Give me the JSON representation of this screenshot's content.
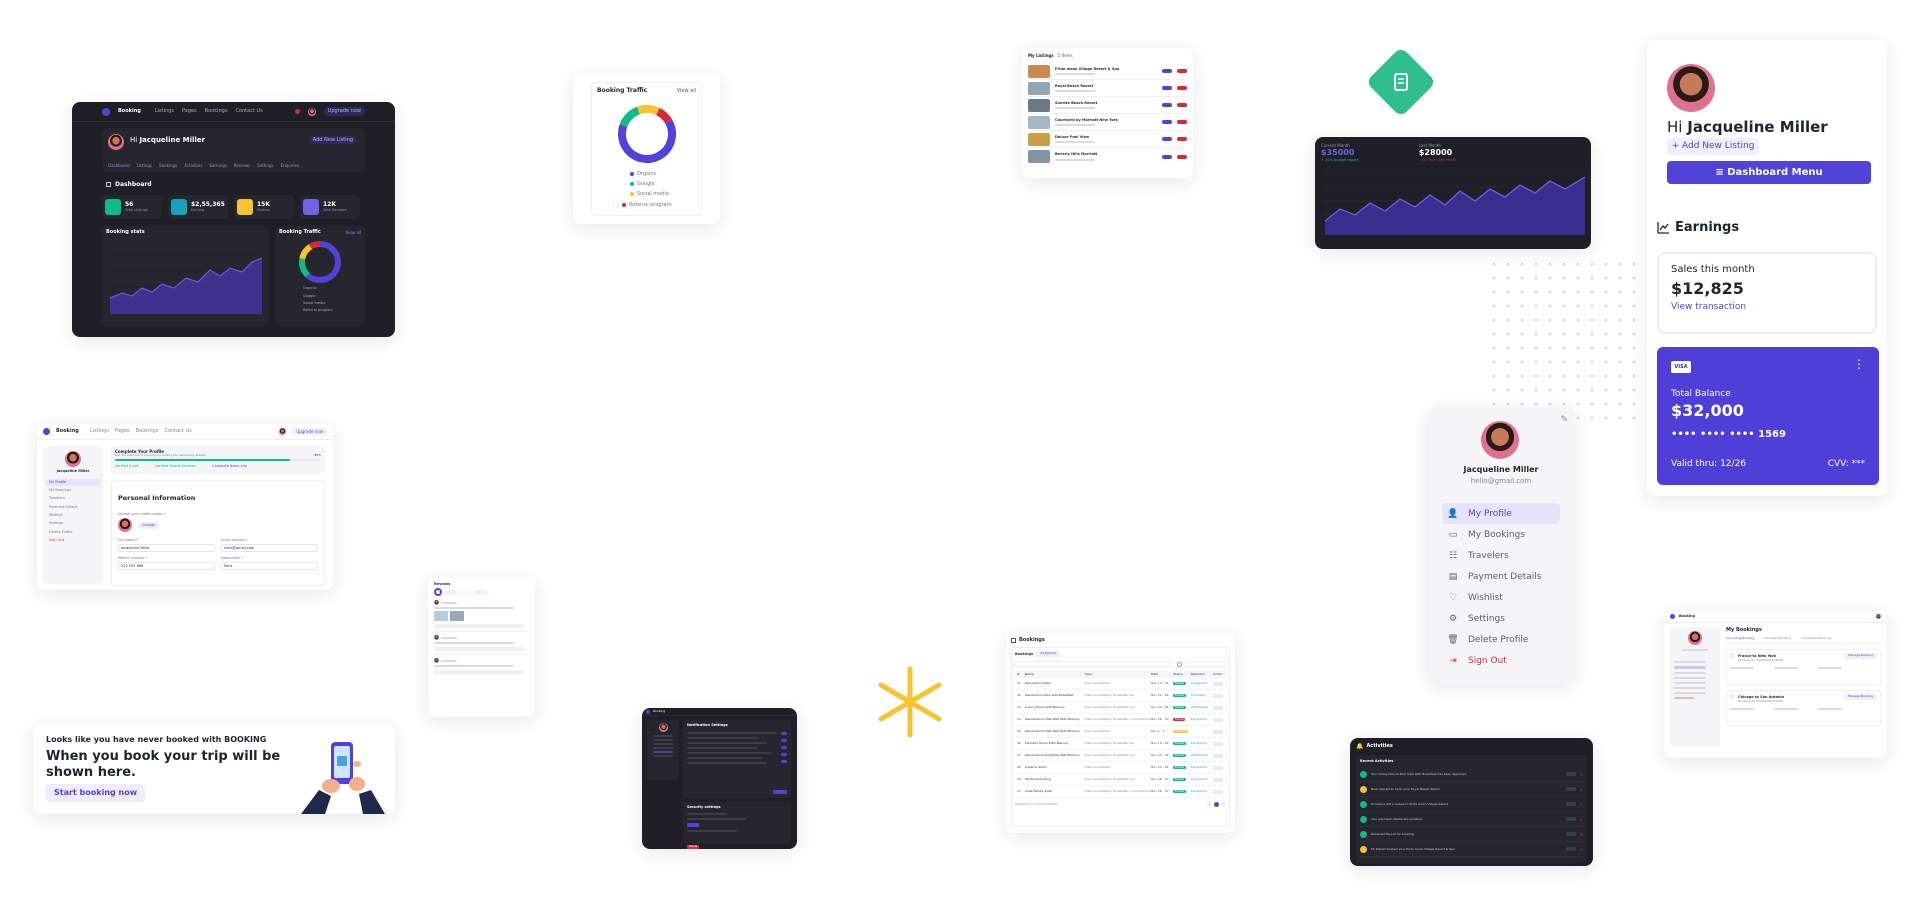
{
  "brand": {
    "name": "Booking",
    "accent": "#5143d9",
    "dark_bg": "#1f2027"
  },
  "nav": {
    "links": [
      "Listings",
      "Pages",
      "Bookings",
      "Contact Us"
    ],
    "add_listing": "Add New Listing",
    "upgrade": "Upgrade now"
  },
  "dashboard": {
    "greeting": "Hi",
    "user": "Jacqueline Miller",
    "tabs": [
      "Dashboard",
      "Listings",
      "Bookings",
      "Activities",
      "Earnings",
      "Reviews",
      "Settings",
      "Enquiries"
    ],
    "section": "Dashboard",
    "stats": [
      {
        "value": "56",
        "label": "Total Listings",
        "color": "#0cbc87"
      },
      {
        "value": "$2,55,365",
        "label": "Earning",
        "color": "#17a2b8"
      },
      {
        "value": "15K",
        "label": "Visitors",
        "color": "#f7c32e"
      },
      {
        "value": "12K",
        "label": "Total Reviews",
        "color": "#6f63e6"
      }
    ],
    "booking_stats": "Booking stats",
    "booking_traffic": "Booking Traffic",
    "view_all": "View all",
    "legend": [
      "Organic",
      "Google",
      "Social media",
      "Referral program"
    ]
  },
  "traffic_card": {
    "title": "Booking Traffic",
    "view_all": "View all",
    "legend": [
      {
        "label": "Organic",
        "color": "#5143d9"
      },
      {
        "label": "Google",
        "color": "#0cbc87"
      },
      {
        "label": "Social media",
        "color": "#f7c32e"
      },
      {
        "label": "Referral program",
        "color": "#d6293e"
      }
    ]
  },
  "listings_card": {
    "title": "My Listings",
    "count": "5 Items",
    "rows": [
      "Pride moon Village Resort & Spa",
      "Royal Beach Resort",
      "Sunrise Beach Resort",
      "Courtyard by Marriott New York",
      "Deluxe Pool View",
      "Beverly Hills Marriott"
    ]
  },
  "earnings_graph": {
    "current_label": "Current Month",
    "current_value": "$35000",
    "current_note": "+ 10%  budget month",
    "last_label": "Last Month",
    "last_value": "$28000",
    "last_note": "- 3%  Than last month"
  },
  "profile_card": {
    "greeting": "Hi",
    "name": "Jacqueline Miller",
    "add_listing": "+ Add New Listing",
    "menu_button": "≡  Dashboard Menu",
    "earnings_title": "Earnings",
    "sales_label": "Sales this month",
    "sales_value": "$12,825",
    "view_transaction": "View transaction",
    "card_brand": "VISA",
    "balance_label": "Total Balance",
    "balance_value": "$32,000",
    "card_number": "•••• •••• •••• 1569",
    "valid": "Valid thru: 12/26",
    "cvv": "CVV: ***"
  },
  "sidebar_card": {
    "name": "Jacqueline Miller",
    "email": "hello@gmail.com",
    "items": [
      {
        "label": "My Profile",
        "icon": "user-icon",
        "active": true
      },
      {
        "label": "My Bookings",
        "icon": "ticket-icon",
        "active": false
      },
      {
        "label": "Travelers",
        "icon": "people-icon",
        "active": false
      },
      {
        "label": "Payment Details",
        "icon": "wallet-icon",
        "active": false
      },
      {
        "label": "Wishlist",
        "icon": "heart-icon",
        "active": false
      },
      {
        "label": "Settings",
        "icon": "gear-icon",
        "active": false
      },
      {
        "label": "Delete Profile",
        "icon": "trash-icon",
        "active": false
      },
      {
        "label": "Sign Out",
        "icon": "signout-icon",
        "active": false,
        "danger": true
      }
    ]
  },
  "profile_page": {
    "complete_title": "Complete Your Profile",
    "complete_text": "Get the best out of booking by adding the remaining details!",
    "percent": "85%",
    "checks": [
      "Verified Email",
      "Verified Mobile Number",
      "Complete Basic Info"
    ],
    "personal_title": "Personal Information",
    "upload_label": "Upload your profile photo *",
    "change": "Change",
    "fields": [
      {
        "label": "Full Name *",
        "value": "Jacqueline Miller"
      },
      {
        "label": "Email address *",
        "value": "hello@gmail.com"
      },
      {
        "label": "Mobile number *",
        "value": "222 555 666"
      },
      {
        "label": "Nationality *",
        "value": "Paris"
      }
    ],
    "side_items": [
      "My Profile",
      "My Bookings",
      "Travelers",
      "Payment Details",
      "Wishlist",
      "Settings",
      "Delete Profile",
      "Sign Out"
    ]
  },
  "empty_booking": {
    "eyebrow": "Looks like you have never booked with BOOKING",
    "headline": "When you book your trip will be shown here.",
    "button": "Start booking now"
  },
  "reviews_card": {
    "title": "Reviews"
  },
  "notifications_card": {
    "title": "Notification Settings",
    "security_title": "Security settings",
    "delete": "Delete"
  },
  "bookings_card": {
    "title": "Bookings",
    "subtitle": "Bookings",
    "badge": "20 Reports",
    "headers": [
      "#",
      "Name",
      "Type",
      "Date",
      "Status",
      "Payment",
      "Action"
    ],
    "rows": [
      {
        "n": "01",
        "name": "Deluxe Pool View",
        "type": "Free cancellation",
        "date": "Nov 19 - 26",
        "status": "Booked",
        "payment": "Full payment"
      },
      {
        "n": "02",
        "name": "Deluxe Pool View with Breakfast",
        "type": "Free cancellation | Breakfast only",
        "date": "Nov 22 - 26",
        "status": "Booked",
        "payment": "On Property"
      },
      {
        "n": "03",
        "name": "Luxury Room with Balcony",
        "type": "Free cancellation | Breakfast only",
        "date": "Nov 24 - 28",
        "status": "Booked",
        "payment": "Half Payment"
      },
      {
        "n": "04",
        "name": "Deluxe Room Twin Bed With Balcony",
        "type": "Free cancellation | Breakfast + Lunch/Dinner",
        "date": "Nov 28 - 30",
        "status": "Cancel",
        "payment": "Full payment"
      },
      {
        "n": "05",
        "name": "Deluxe Room Twin Bed With Balcony",
        "type": "Free cancellation",
        "date": "Dec 1 - 4",
        "status": "Available",
        "payment": ""
      },
      {
        "n": "06",
        "name": "Premium Room With Balcony",
        "type": "Free cancellation | Breakfast only",
        "date": "Nov 19 - 26",
        "status": "Booked",
        "payment": "Full payment"
      },
      {
        "n": "07",
        "name": "Deluxe Room King Bed With Balcony",
        "type": "Free cancellation | Breakfast only",
        "date": "Nov 22 - 26",
        "status": "Booked",
        "payment": "Half Payment"
      },
      {
        "n": "08",
        "name": "Superior Room",
        "type": "Free cancellation",
        "date": "Nov 24 - 28",
        "status": "Booked",
        "payment": "Full payment"
      },
      {
        "n": "09",
        "name": "Studio Suite King",
        "type": "Free cancellation | Breakfast only",
        "date": "Nov 28 - 30",
        "status": "Booked",
        "payment": "Full payment"
      },
      {
        "n": "10",
        "name": "Suite Family Suite",
        "type": "Free cancellation | Breakfast + Lunch/Dinner",
        "date": "Nov 28 - 30",
        "status": "Booked",
        "payment": "Full payment"
      }
    ],
    "footer": "Showing 1 to 8 of 20 entries"
  },
  "activities_card": {
    "title": "Activities",
    "subtitle": "Recent Activities",
    "items": [
      {
        "text": "Your listing Deluxe Pool View with Breakfast has been approved",
        "color": "#0cbc87"
      },
      {
        "text": "New request to book your Royal Beach Resort",
        "color": "#f7c32e"
      },
      {
        "text": "Someone left a review to Pride moon Village Resort",
        "color": "#0cbc87"
      },
      {
        "text": "Your payment details are updated",
        "color": "#0cbc87"
      },
      {
        "text": "Received Payout for booking",
        "color": "#0cbc87"
      },
      {
        "text": "Mr Robert booked your Pride moon Village Resort & Spa",
        "color": "#f7c32e"
      }
    ]
  },
  "my_bookings_card": {
    "title": "My Bookings",
    "tabs": [
      "Upcoming Booking",
      "Canceled Booking",
      "Completed Booking"
    ],
    "items": [
      {
        "title": "France to New York",
        "booking_id": "Booking ID: CGDSUAHA12548",
        "button": "Manage Booking"
      },
      {
        "title": "Chicago to San Antonio",
        "booking_id": "Booking ID: CGDSUAHA12548",
        "button": "Manage Booking"
      }
    ]
  }
}
